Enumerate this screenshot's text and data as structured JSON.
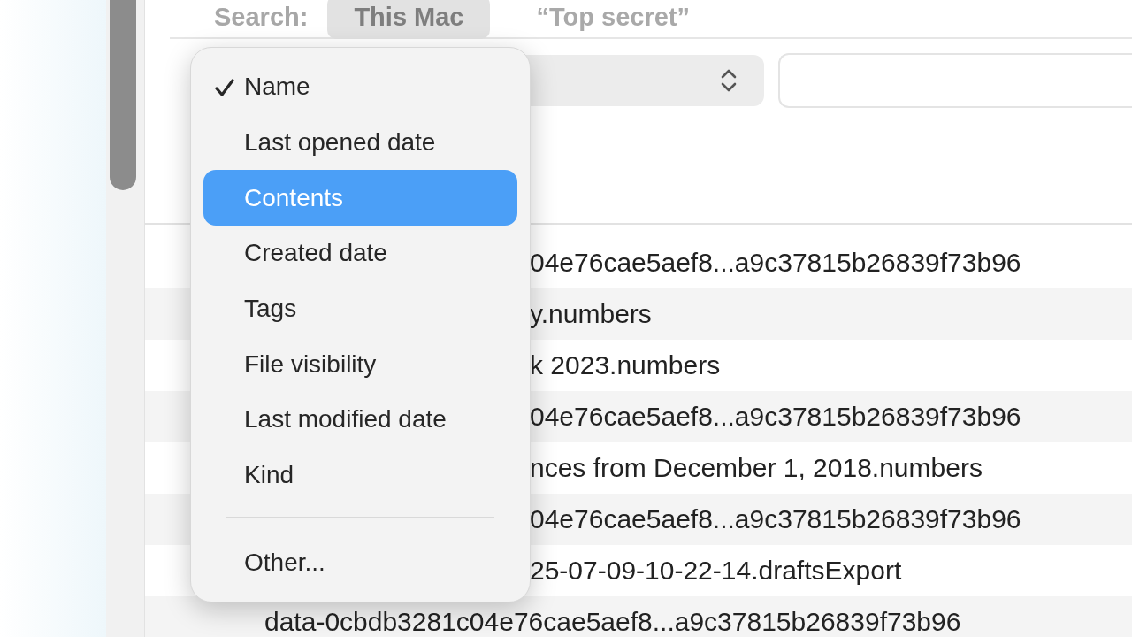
{
  "search_bar": {
    "label": "Search:",
    "scopes": [
      {
        "label": "This Mac",
        "selected": true
      },
      {
        "label": "“Top secret”",
        "selected": false
      }
    ]
  },
  "rows": [
    {
      "name": "04e76cae5aef8...a9c37815b26839f73b96",
      "partly_hidden": true
    },
    {
      "name": "y.numbers",
      "partly_hidden": true
    },
    {
      "name": "k 2023.numbers",
      "partly_hidden": true
    },
    {
      "name": "04e76cae5aef8...a9c37815b26839f73b96",
      "partly_hidden": true
    },
    {
      "name": "nces from December 1, 2018.numbers",
      "partly_hidden": true
    },
    {
      "name": "04e76cae5aef8...a9c37815b26839f73b96",
      "partly_hidden": true
    },
    {
      "name": "25-07-09-10-22-14.draftsExport",
      "partly_hidden": true
    },
    {
      "name": "data-0cbdb3281c04e76cae5aef8...a9c37815b26839f73b96",
      "partly_hidden": false
    }
  ],
  "menu": {
    "items": [
      {
        "kind": "item",
        "label": "Name",
        "checked": true,
        "selected": false
      },
      {
        "kind": "item",
        "label": "Last opened date",
        "checked": false,
        "selected": false
      },
      {
        "kind": "item",
        "label": "Contents",
        "checked": false,
        "selected": true
      },
      {
        "kind": "item",
        "label": "Created date",
        "checked": false,
        "selected": false
      },
      {
        "kind": "item",
        "label": "Tags",
        "checked": false,
        "selected": false
      },
      {
        "kind": "item",
        "label": "File visibility",
        "checked": false,
        "selected": false
      },
      {
        "kind": "item",
        "label": "Last modified date",
        "checked": false,
        "selected": false
      },
      {
        "kind": "item",
        "label": "Kind",
        "checked": false,
        "selected": false
      },
      {
        "kind": "separator"
      },
      {
        "kind": "item",
        "label": "Other...",
        "checked": false,
        "selected": false
      }
    ]
  }
}
